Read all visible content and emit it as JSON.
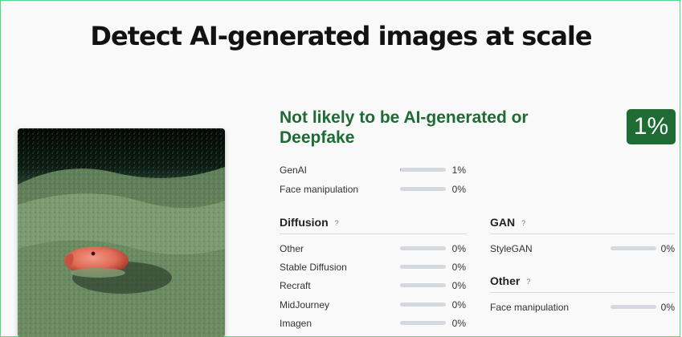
{
  "headline": "Detect AI-generated images at scale",
  "verdict": "Not likely to be AI-generated or Deepfake",
  "score": "1%",
  "summary": [
    {
      "label": "GenAI",
      "percent": "1%",
      "value": 1
    },
    {
      "label": "Face manipulation",
      "percent": "0%",
      "value": 0
    }
  ],
  "diffusion": {
    "title": "Diffusion",
    "help": "?",
    "items": [
      {
        "label": "Other",
        "percent": "0%",
        "value": 0
      },
      {
        "label": "Stable Diffusion",
        "percent": "0%",
        "value": 0
      },
      {
        "label": "Recraft",
        "percent": "0%",
        "value": 0
      },
      {
        "label": "MidJourney",
        "percent": "0%",
        "value": 0
      },
      {
        "label": "Imagen",
        "percent": "0%",
        "value": 0
      }
    ]
  },
  "gan": {
    "title": "GAN",
    "help": "?",
    "items": [
      {
        "label": "StyleGAN",
        "percent": "0%",
        "value": 0
      }
    ]
  },
  "other": {
    "title": "Other",
    "help": "?",
    "items": [
      {
        "label": "Face manipulation",
        "percent": "0%",
        "value": 0
      }
    ]
  },
  "colors": {
    "verdict_green": "#1e6b34",
    "frame_border": "#4ade80",
    "bar_track": "#d4d9df"
  }
}
